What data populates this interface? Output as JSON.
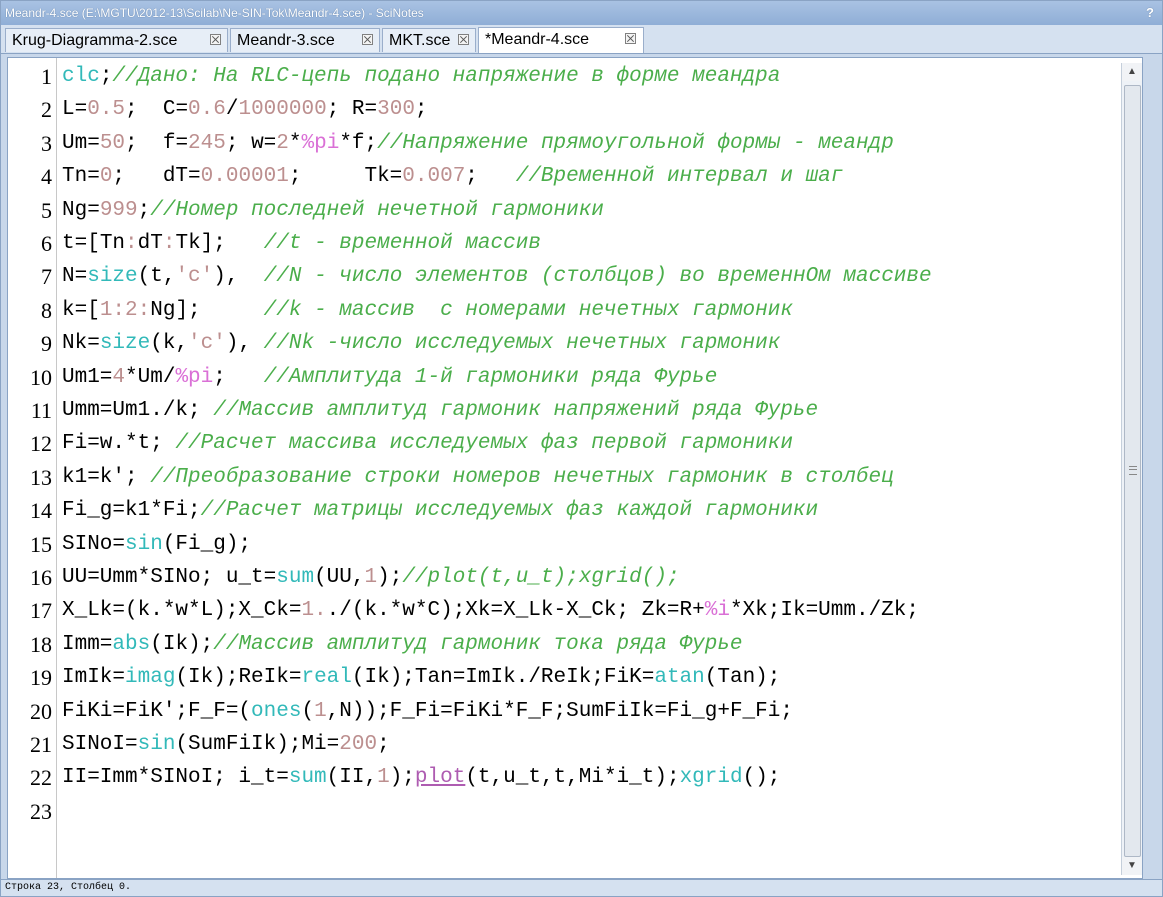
{
  "window": {
    "title": "Meandr-4.sce (E:\\MGTU\\2012-13\\Scilab\\Ne-SIN-Tok\\Meandr-4.sce) - SciNotes",
    "help": "?"
  },
  "tabs": [
    {
      "label": "Krug-Diagramma-2.sce",
      "active": false
    },
    {
      "label": "Meandr-3.sce",
      "active": false
    },
    {
      "label": "MKT.sce",
      "active": false
    },
    {
      "label": "*Meandr-4.sce",
      "active": true
    }
  ],
  "editor": {
    "line_numbers": [
      "1",
      "2",
      "3",
      "4",
      "5",
      "6",
      "7",
      "8",
      "9",
      "10",
      "11",
      "12",
      "13",
      "14",
      "15",
      "16",
      "17",
      "18",
      "19",
      "20",
      "21",
      "22",
      "23"
    ],
    "lines": [
      [
        [
          "kw",
          "clc"
        ],
        [
          "op",
          ";"
        ],
        [
          "com",
          "//Дано: На RLC-цепь подано напряжение в форме меандра"
        ]
      ],
      [
        [
          "op",
          "L="
        ],
        [
          "num",
          "0.5"
        ],
        [
          "op",
          ";  C="
        ],
        [
          "num",
          "0.6"
        ],
        [
          "op",
          "/"
        ],
        [
          "num",
          "1000000"
        ],
        [
          "op",
          "; R="
        ],
        [
          "num",
          "300"
        ],
        [
          "op",
          ";"
        ]
      ],
      [
        [
          "op",
          "Um="
        ],
        [
          "num",
          "50"
        ],
        [
          "op",
          ";  f="
        ],
        [
          "num",
          "245"
        ],
        [
          "op",
          "; w="
        ],
        [
          "num",
          "2"
        ],
        [
          "op",
          "*"
        ],
        [
          "cst",
          "%pi"
        ],
        [
          "op",
          "*f;"
        ],
        [
          "com",
          "//Напряжение прямоугольной формы - меандр"
        ]
      ],
      [
        [
          "op",
          "Tn="
        ],
        [
          "num",
          "0"
        ],
        [
          "op",
          ";   dT="
        ],
        [
          "num",
          "0.00001"
        ],
        [
          "op",
          ";     Tk="
        ],
        [
          "num",
          "0.007"
        ],
        [
          "op",
          ";   "
        ],
        [
          "com",
          "//Временной интервал и шаг"
        ]
      ],
      [
        [
          "op",
          "Ng="
        ],
        [
          "num",
          "999"
        ],
        [
          "op",
          ";"
        ],
        [
          "com",
          "//Номер последней нечетной гармоники"
        ]
      ],
      [
        [
          "op",
          "t=["
        ],
        [
          "op",
          "Tn"
        ],
        [
          "num",
          ":"
        ],
        [
          "op",
          "dT"
        ],
        [
          "num",
          ":"
        ],
        [
          "op",
          "Tk];   "
        ],
        [
          "com",
          "//t - временной массив"
        ]
      ],
      [
        [
          "op",
          "N="
        ],
        [
          "kw",
          "size"
        ],
        [
          "op",
          "(t,"
        ],
        [
          "str",
          "'c'"
        ],
        [
          "op",
          "),  "
        ],
        [
          "com",
          "//N - число элементов (столбцов) во временнОм массиве"
        ]
      ],
      [
        [
          "op",
          "k=["
        ],
        [
          "num",
          "1"
        ],
        [
          "num",
          ":"
        ],
        [
          "num",
          "2"
        ],
        [
          "num",
          ":"
        ],
        [
          "op",
          "Ng];     "
        ],
        [
          "com",
          "//k - массив  с номерами нечетных гармоник"
        ]
      ],
      [
        [
          "op",
          "Nk="
        ],
        [
          "kw",
          "size"
        ],
        [
          "op",
          "(k,"
        ],
        [
          "str",
          "'c'"
        ],
        [
          "op",
          "), "
        ],
        [
          "com",
          "//Nk -число исследуемых нечетных гармоник"
        ]
      ],
      [
        [
          "op",
          "Um1="
        ],
        [
          "num",
          "4"
        ],
        [
          "op",
          "*Um/"
        ],
        [
          "cst",
          "%pi"
        ],
        [
          "op",
          ";   "
        ],
        [
          "com",
          "//Амплитуда 1-й гармоники ряда Фурье"
        ]
      ],
      [
        [
          "op",
          "Umm=Um1./k; "
        ],
        [
          "com",
          "//Массив амплитуд гармоник напряжений ряда Фурье"
        ]
      ],
      [
        [
          "op",
          "Fi=w.*t; "
        ],
        [
          "com",
          "//Расчет массива исследуемых фаз первой гармоники"
        ]
      ],
      [
        [
          "op",
          "k1=k'; "
        ],
        [
          "com",
          "//Преобразование строки номеров нечетных гармоник в столбец"
        ]
      ],
      [
        [
          "op",
          "Fi_g=k1*Fi;"
        ],
        [
          "com",
          "//Расчет матрицы исследуемых фаз каждой гармоники"
        ]
      ],
      [
        [
          "op",
          "SINo="
        ],
        [
          "kw",
          "sin"
        ],
        [
          "op",
          "(Fi_g);"
        ]
      ],
      [
        [
          "op",
          "UU=Umm*SINo; u_t="
        ],
        [
          "kw",
          "sum"
        ],
        [
          "op",
          "(UU,"
        ],
        [
          "num",
          "1"
        ],
        [
          "op",
          ");"
        ],
        [
          "com",
          "//plot(t,u_t);xgrid();"
        ]
      ],
      [
        [
          "op",
          "X_Lk=(k.*w*L);X_Ck="
        ],
        [
          "num",
          "1."
        ],
        [
          "op",
          "./(k.*w*C);Xk=X_Lk-X_Ck; Zk=R+"
        ],
        [
          "cst",
          "%i"
        ],
        [
          "op",
          "*Xk;Ik=Umm./Zk;"
        ]
      ],
      [
        [
          "op",
          "Imm="
        ],
        [
          "kw",
          "abs"
        ],
        [
          "op",
          "(Ik);"
        ],
        [
          "com",
          "//Массив амплитуд гармоник тока ряда Фурье"
        ]
      ],
      [
        [
          "op",
          "ImIk="
        ],
        [
          "kw",
          "imag"
        ],
        [
          "op",
          "(Ik);ReIk="
        ],
        [
          "kw",
          "real"
        ],
        [
          "op",
          "(Ik);Tan=ImIk./ReIk;FiK="
        ],
        [
          "kw",
          "atan"
        ],
        [
          "op",
          "(Tan);"
        ]
      ],
      [
        [
          "op",
          "FiKi=FiK';F_F=("
        ],
        [
          "kw",
          "ones"
        ],
        [
          "op",
          "("
        ],
        [
          "num",
          "1"
        ],
        [
          "op",
          ",N));F_Fi=FiKi*F_F;SumFiIk=Fi_g+F_Fi;"
        ]
      ],
      [
        [
          "op",
          "SINoI="
        ],
        [
          "kw",
          "sin"
        ],
        [
          "op",
          "(SumFiIk);Mi="
        ],
        [
          "num",
          "200"
        ],
        [
          "op",
          ";"
        ]
      ],
      [
        [
          "op",
          "II=Imm*SINoI; i_t="
        ],
        [
          "kw",
          "sum"
        ],
        [
          "op",
          "(II,"
        ],
        [
          "num",
          "1"
        ],
        [
          "op",
          ");"
        ],
        [
          "plot",
          "plot"
        ],
        [
          "op",
          "(t,u_t,t,Mi*i_t);"
        ],
        [
          "kw",
          "xgrid"
        ],
        [
          "op",
          "();"
        ]
      ],
      [
        [
          "op",
          ""
        ]
      ]
    ]
  },
  "status": {
    "text": "Строка 23, Столбец 0."
  },
  "colors": {
    "keyword": "#32b9b9",
    "number": "#bc8f8f",
    "comment": "#4bae4b",
    "constant": "#da70d6"
  }
}
